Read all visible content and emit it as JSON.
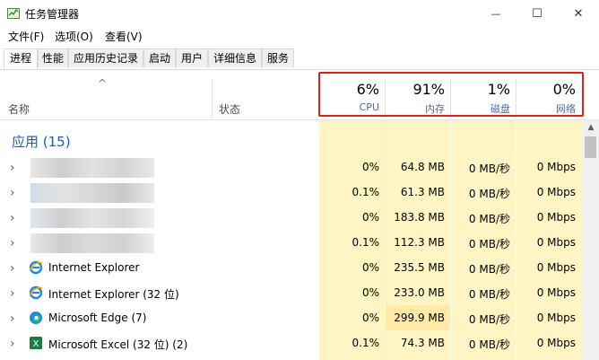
{
  "window": {
    "title": "任务管理器",
    "controls": {
      "minimize": "—",
      "maximize": "☐",
      "close": "✕"
    }
  },
  "menu": [
    "文件(F)",
    "选项(O)",
    "查看(V)"
  ],
  "tabs": [
    "进程",
    "性能",
    "应用历史记录",
    "启动",
    "用户",
    "详细信息",
    "服务"
  ],
  "columns": {
    "sort_indicator": "^",
    "name": "名称",
    "status": "状态",
    "cpu": {
      "percent": "6%",
      "label": "CPU"
    },
    "memory": {
      "percent": "91%",
      "label": "内存"
    },
    "disk": {
      "percent": "1%",
      "label": "磁盘"
    },
    "network": {
      "percent": "0%",
      "label": "网络"
    }
  },
  "group": {
    "title": "应用 (15)"
  },
  "rows": [
    {
      "name": "",
      "cpu": "0%",
      "memory": "64.8 MB",
      "disk": "0 MB/秒",
      "network": "0 Mbps",
      "icon": "blurred-icon"
    },
    {
      "name": "",
      "cpu": "0.1%",
      "memory": "61.3 MB",
      "disk": "0 MB/秒",
      "network": "0 Mbps",
      "icon": "blurred-icon"
    },
    {
      "name": "",
      "cpu": "0%",
      "memory": "183.8 MB",
      "disk": "0 MB/秒",
      "network": "0 Mbps",
      "icon": "blurred-icon"
    },
    {
      "name": "",
      "cpu": "0.1%",
      "memory": "112.3 MB",
      "disk": "0 MB/秒",
      "network": "0 Mbps",
      "icon": "blurred-icon"
    },
    {
      "name": "Internet Explorer",
      "cpu": "0%",
      "memory": "235.5 MB",
      "disk": "0 MB/秒",
      "network": "0 Mbps",
      "icon": "internet-explorer-icon"
    },
    {
      "name": "Internet Explorer (32 位)",
      "cpu": "0%",
      "memory": "233.0 MB",
      "disk": "0 MB/秒",
      "network": "0 Mbps",
      "icon": "internet-explorer-icon"
    },
    {
      "name": "Microsoft Edge (7)",
      "cpu": "0%",
      "memory": "299.9 MB",
      "disk": "0 MB/秒",
      "network": "0 Mbps",
      "icon": "edge-icon"
    },
    {
      "name": "Microsoft Excel (32 位) (2)",
      "cpu": "0.1%",
      "memory": "74.3 MB",
      "disk": "0 MB/秒",
      "network": "0 Mbps",
      "icon": "excel-icon"
    }
  ],
  "colors": {
    "highlight_red": "#e02020",
    "group_blue": "#1a5fb4",
    "heat_light": "#fff4c4",
    "heat_mid": "#ffe9a6"
  }
}
